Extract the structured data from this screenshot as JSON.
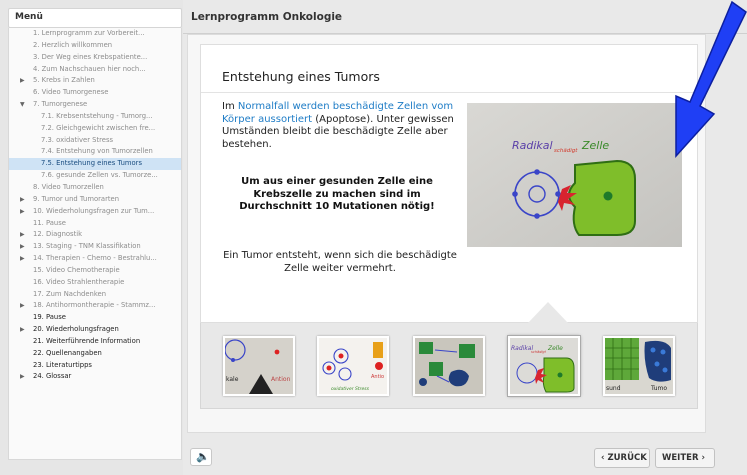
{
  "menu": {
    "header": "Menü",
    "items": [
      {
        "label": "1. Lernprogramm zur Vorbereit...",
        "level": 0,
        "arrow": "",
        "style": ""
      },
      {
        "label": "2. Herzlich willkommen",
        "level": 0,
        "arrow": "",
        "style": ""
      },
      {
        "label": "3. Der Weg eines Krebspatiente...",
        "level": 0,
        "arrow": "",
        "style": ""
      },
      {
        "label": "4. Zum Nachschauen hier noch...",
        "level": 0,
        "arrow": "",
        "style": ""
      },
      {
        "label": "5. Krebs in Zahlen",
        "level": 0,
        "arrow": "▶",
        "style": ""
      },
      {
        "label": "6. Video Tumorgenese",
        "level": 0,
        "arrow": "",
        "style": ""
      },
      {
        "label": "7. Tumorgenese",
        "level": 0,
        "arrow": "▼",
        "style": ""
      },
      {
        "label": "7.1. Krebsentstehung - Tumorg...",
        "level": 1,
        "arrow": "",
        "style": ""
      },
      {
        "label": "7.2. Gleichgewicht zwischen fre...",
        "level": 1,
        "arrow": "",
        "style": ""
      },
      {
        "label": "7.3. oxidativer Stress",
        "level": 1,
        "arrow": "",
        "style": ""
      },
      {
        "label": "7.4. Entstehung von Tumorzellen",
        "level": 1,
        "arrow": "",
        "style": ""
      },
      {
        "label": "7.5. Entstehung eines Tumors",
        "level": 1,
        "arrow": "",
        "style": "selected"
      },
      {
        "label": "7.6. gesunde Zellen vs. Tumorze...",
        "level": 1,
        "arrow": "",
        "style": ""
      },
      {
        "label": "8. Video Tumorzellen",
        "level": 0,
        "arrow": "",
        "style": ""
      },
      {
        "label": "9. Tumor und Tumorarten",
        "level": 0,
        "arrow": "▶",
        "style": ""
      },
      {
        "label": "10. Wiederholungsfragen zur Tum...",
        "level": 0,
        "arrow": "▶",
        "style": ""
      },
      {
        "label": "11. Pause",
        "level": 0,
        "arrow": "",
        "style": ""
      },
      {
        "label": "12. Diagnostik",
        "level": 0,
        "arrow": "▶",
        "style": ""
      },
      {
        "label": "13. Staging - TNM Klassifikation",
        "level": 0,
        "arrow": "▶",
        "style": ""
      },
      {
        "label": "14. Therapien - Chemo - Bestrahlu...",
        "level": 0,
        "arrow": "▶",
        "style": ""
      },
      {
        "label": "15. Video Chemotherapie",
        "level": 0,
        "arrow": "",
        "style": ""
      },
      {
        "label": "16. Video Strahlentherapie",
        "level": 0,
        "arrow": "",
        "style": ""
      },
      {
        "label": "17. Zum Nachdenken",
        "level": 0,
        "arrow": "",
        "style": ""
      },
      {
        "label": "18. Antihormontherapie - Stammz...",
        "level": 0,
        "arrow": "▶",
        "style": ""
      },
      {
        "label": "19. Pause",
        "level": 0,
        "arrow": "",
        "style": "dark"
      },
      {
        "label": "20. Wiederholungsfragen",
        "level": 0,
        "arrow": "▶",
        "style": "dark"
      },
      {
        "label": "21. Weiterführende Information",
        "level": 0,
        "arrow": "",
        "style": "dark"
      },
      {
        "label": "22. Quellenangaben",
        "level": 0,
        "arrow": "",
        "style": "dark"
      },
      {
        "label": "23. Literaturtipps",
        "level": 0,
        "arrow": "",
        "style": "dark"
      },
      {
        "label": "24. Glossar",
        "level": 0,
        "arrow": "▶",
        "style": "dark"
      }
    ]
  },
  "header": {
    "title": "Lernprogramm Onkologie"
  },
  "slide": {
    "title": "Entstehung eines Tumors",
    "para1_prefix": "Im ",
    "para1_highlight": "Normalfall werden beschädigte Zellen vom Körper aussortiert",
    "para1_suffix": " (Apoptose). Unter gewissen Umständen bleibt die beschädigte Zelle aber bestehen.",
    "bold_text": "Um aus einer gesunden Zelle eine Krebszelle zu machen sind im Durchschnitt 10 Mutationen nötig!",
    "para2": "Ein Tumor entsteht, wenn sich die beschädigte Zelle weiter vermehrt.",
    "image_labels": {
      "radikal": "Radikal",
      "schaedigt": "schädigt",
      "zelle": "Zelle"
    }
  },
  "thumbnails": {
    "t1": {
      "word1": "kale",
      "word2": "Antion"
    },
    "t2": {
      "word1": "Antio",
      "caption": "oxidativer Stress"
    },
    "t4": {
      "word1": "Radikal",
      "word2": "schädigt",
      "word3": "Zelle"
    },
    "t5": {
      "word1": "sund",
      "word2": "Tumo"
    }
  },
  "nav": {
    "back_label": "ZURÜCK",
    "next_label": "WEITER"
  },
  "colors": {
    "accent": "#1e7cc6",
    "selected_bg": "#cfe3f5",
    "arrow_blue": "#1f3ff5"
  }
}
